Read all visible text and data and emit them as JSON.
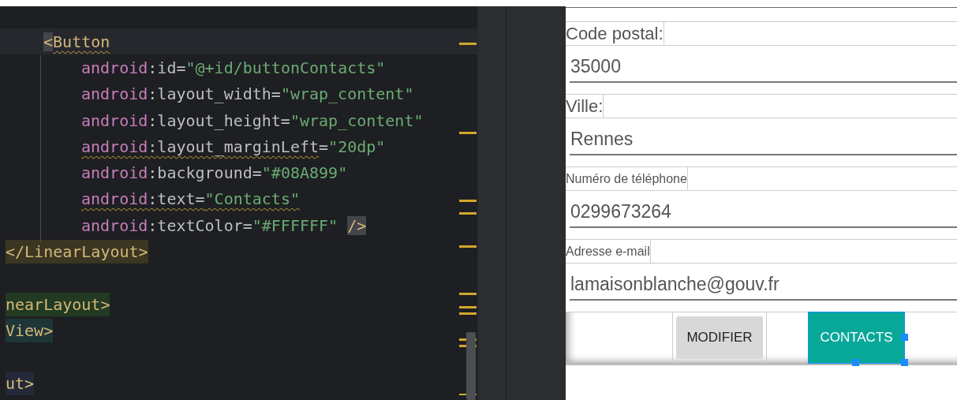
{
  "editor": {
    "lines": [
      {
        "kind": "element",
        "current": true,
        "tokens": [
          {
            "kind": "bracket_match",
            "text": "<"
          },
          {
            "kind": "tag",
            "text": "Button",
            "warning": true
          }
        ]
      },
      {
        "kind": "attribute",
        "tokens": [
          {
            "kind": "ns",
            "text": "android"
          },
          {
            "kind": "punct",
            "text": ":id="
          },
          {
            "kind": "string",
            "text": "\"@+id/buttonContacts\""
          }
        ]
      },
      {
        "kind": "attribute",
        "tokens": [
          {
            "kind": "ns",
            "text": "android"
          },
          {
            "kind": "punct",
            "text": ":layout_width="
          },
          {
            "kind": "string",
            "text": "\"wrap_content\""
          }
        ]
      },
      {
        "kind": "attribute",
        "tokens": [
          {
            "kind": "ns",
            "text": "android"
          },
          {
            "kind": "punct",
            "text": ":layout_height="
          },
          {
            "kind": "string",
            "text": "\"wrap_content\""
          }
        ]
      },
      {
        "kind": "attribute",
        "tokens": [
          {
            "kind": "ns",
            "text": "android",
            "warning": true
          },
          {
            "kind": "punct",
            "text": ":layout_marginLeft",
            "warning": true
          },
          {
            "kind": "punct",
            "text": "="
          },
          {
            "kind": "string",
            "text": "\"20dp\""
          }
        ]
      },
      {
        "kind": "attribute",
        "tokens": [
          {
            "kind": "ns",
            "text": "android"
          },
          {
            "kind": "punct",
            "text": ":background="
          },
          {
            "kind": "string",
            "text": "\"#08A899\""
          }
        ]
      },
      {
        "kind": "attribute",
        "tokens": [
          {
            "kind": "ns",
            "text": "android",
            "warning": true
          },
          {
            "kind": "punct",
            "text": ":text=",
            "warning": true
          },
          {
            "kind": "string",
            "text": "\"Contacts\"",
            "warning": true
          }
        ]
      },
      {
        "kind": "attribute",
        "tokens": [
          {
            "kind": "ns",
            "text": "android"
          },
          {
            "kind": "punct",
            "text": ":textColor="
          },
          {
            "kind": "string",
            "text": "\"#FFFFFF\""
          },
          {
            "kind": "self_close",
            "text": "/>"
          }
        ]
      },
      {
        "kind": "closing",
        "color": "#3a3622",
        "tokens": [
          {
            "kind": "tag",
            "text": "</LinearLayout>"
          }
        ]
      },
      {
        "kind": "blank"
      },
      {
        "kind": "closing",
        "color": "#213a21",
        "tokens": [
          {
            "kind": "tag",
            "text": "nearLayout>"
          }
        ]
      },
      {
        "kind": "closing",
        "color": "#1e3638",
        "tokens": [
          {
            "kind": "tag",
            "text": "View>"
          }
        ]
      },
      {
        "kind": "blank"
      },
      {
        "kind": "closing",
        "color": "#24293a",
        "tokens": [
          {
            "kind": "tag",
            "text": "ut>"
          }
        ]
      }
    ]
  },
  "preview": {
    "rows": [
      {
        "kind": "label",
        "text": "Code postal:"
      },
      {
        "kind": "input",
        "value": "35000"
      },
      {
        "kind": "label",
        "text": "Ville:"
      },
      {
        "kind": "input",
        "value": "Rennes"
      },
      {
        "kind": "caption",
        "text": "Numéro de téléphone"
      },
      {
        "kind": "input",
        "value": "0299673264"
      },
      {
        "kind": "caption",
        "text": "Adresse e-mail"
      },
      {
        "kind": "input",
        "value": "lamaisonblanche@gouv.fr"
      }
    ],
    "buttons": [
      {
        "kind": "default",
        "label": "MODIFIER",
        "selected": false
      },
      {
        "kind": "accent",
        "label": "CONTACTS",
        "selected": true
      }
    ]
  }
}
